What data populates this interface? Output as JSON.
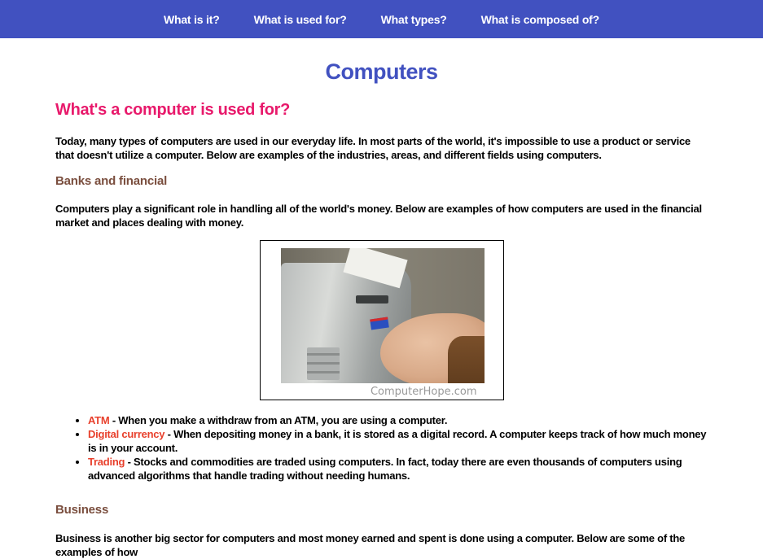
{
  "nav": {
    "items": [
      {
        "label": "What is it?"
      },
      {
        "label": "What is used for?"
      },
      {
        "label": "What types?"
      },
      {
        "label": "What is composed of?"
      }
    ]
  },
  "page": {
    "title": "Computers",
    "section_title": "What's a computer is used for?",
    "intro": "Today, many types of computers are used in our everyday life. In most parts of the world, it's impossible to use a product or service that doesn't utilize a computer. Below are examples of the industries, areas, and different fields using computers."
  },
  "banks": {
    "heading": "Banks and financial",
    "description": "Computers play a significant role in handling all of the world's money. Below are examples of how computers are used in the financial market and places dealing with money.",
    "image_watermark": "ComputerHope.com",
    "list": [
      {
        "term": "ATM",
        "text": " - When you make a withdraw from an ATM, you are using a computer."
      },
      {
        "term": "Digital currency",
        "text": " - When depositing money in a bank, it is stored as a digital record. A computer keeps track of how much money is in your account."
      },
      {
        "term": "Trading",
        "text": " - Stocks and commodities are traded using computers. In fact, today there are even thousands of computers using advanced algorithms that handle trading without needing humans."
      }
    ]
  },
  "business": {
    "heading": "Business",
    "description": "Business is another big sector for computers and most money earned and spent is done using a computer. Below are some of the examples of how"
  },
  "colors": {
    "nav_bg": "#4151c0",
    "title": "#4151c0",
    "section_title": "#e8196b",
    "subsection": "#7a4e3e",
    "term": "#e8402c"
  }
}
